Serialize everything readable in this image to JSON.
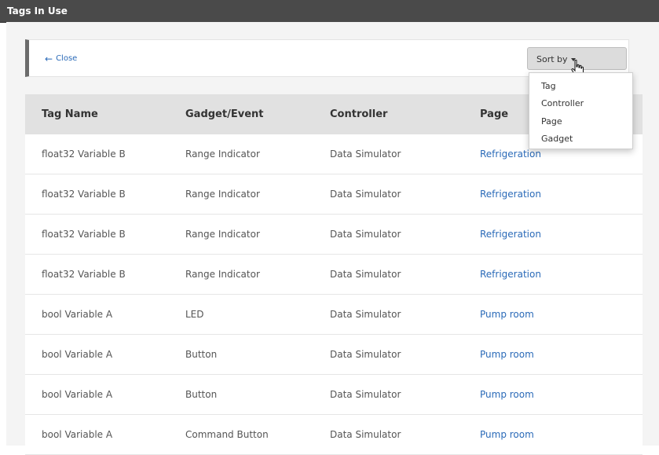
{
  "window": {
    "title": "Tags In Use"
  },
  "toolbar": {
    "close_label": "Close",
    "close_icon": "arrow-left-icon",
    "sort_label": "Sort by"
  },
  "sort_menu": {
    "options": [
      "Tag",
      "Controller",
      "Page",
      "Gadget"
    ]
  },
  "table": {
    "headers": [
      "Tag Name",
      "Gadget/Event",
      "Controller",
      "Page"
    ],
    "rows": [
      [
        "float32 Variable B",
        "Range Indicator",
        "Data Simulator",
        "Refrigeration"
      ],
      [
        "float32 Variable B",
        "Range Indicator",
        "Data Simulator",
        "Refrigeration"
      ],
      [
        "float32 Variable B",
        "Range Indicator",
        "Data Simulator",
        "Refrigeration"
      ],
      [
        "float32 Variable B",
        "Range Indicator",
        "Data Simulator",
        "Refrigeration"
      ],
      [
        "bool Variable A",
        "LED",
        "Data Simulator",
        "Pump room"
      ],
      [
        "bool Variable A",
        "Button",
        "Data Simulator",
        "Pump room"
      ],
      [
        "bool Variable A",
        "Button",
        "Data Simulator",
        "Pump room"
      ],
      [
        "bool Variable A",
        "Command Button",
        "Data Simulator",
        "Pump room"
      ]
    ]
  },
  "colors": {
    "link": "#2a6ab8",
    "titlebar": "#4a4a4a",
    "header_bg": "#e1e1e1"
  }
}
